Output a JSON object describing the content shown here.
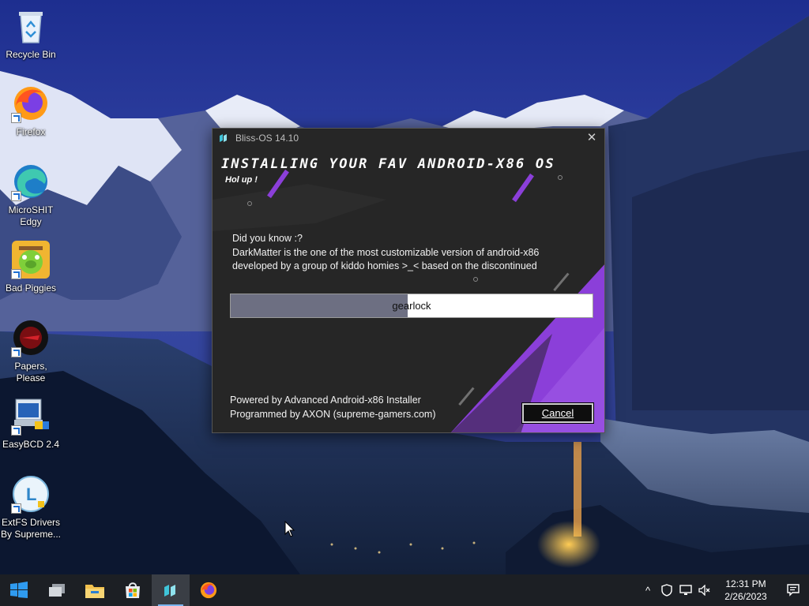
{
  "desktop": {
    "icons": [
      {
        "label": "Recycle Bin",
        "icon": "recycle-bin-icon"
      },
      {
        "label": "Firefox",
        "icon": "firefox-icon"
      },
      {
        "label": "MicroSHIT\nEdgy",
        "icon": "edge-icon"
      },
      {
        "label": "Bad Piggies",
        "icon": "bad-piggies-icon"
      },
      {
        "label": "Papers, Please",
        "icon": "papers-please-icon"
      },
      {
        "label": "EasyBCD 2.4",
        "icon": "easybcd-icon"
      },
      {
        "label": "ExtFS Drivers\nBy Supreme...",
        "icon": "extfs-icon"
      }
    ]
  },
  "dialog": {
    "title": "Bliss-OS 14.10",
    "close_glyph": "✕",
    "headline": "INSTALLING YOUR FAV ANDROID-X86 OS",
    "subhead": "Hol up !",
    "tip_lines": [
      "Did you know :?",
      "DarkMatter is the one of the most customizable version of android-x86",
      "developed by a group of kiddo homies >_< based on the discontinued"
    ],
    "progress": {
      "label": "gearlock",
      "fraction": 0.49
    },
    "credits": [
      "Powered by Advanced Android-x86 Installer",
      "Programmed by AXON (supreme-gamers.com)"
    ],
    "cancel_label": "Cancel",
    "colors": {
      "accent": "#8b3fd9",
      "background": "#262626"
    }
  },
  "taskbar": {
    "items": [
      "start-icon",
      "task-view-icon",
      "file-explorer-icon",
      "store-icon",
      "bliss-installer-icon",
      "firefox-icon"
    ],
    "active_item": "bliss-installer-icon",
    "tray": {
      "chevron": "^",
      "time": "12:31 PM",
      "date": "2/26/2023"
    }
  }
}
